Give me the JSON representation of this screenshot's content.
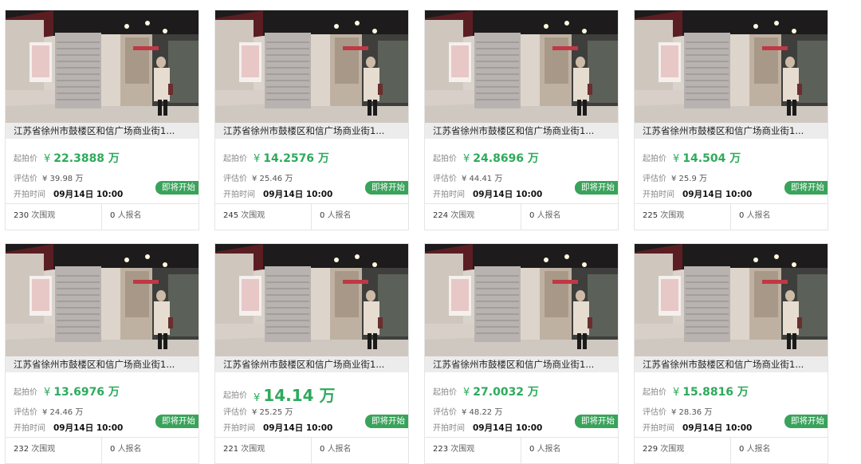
{
  "labels": {
    "start_price": "起拍价",
    "estimate": "评估价",
    "start_time": "开拍时间",
    "status": "即将开始",
    "views_suffix": "次围观",
    "signups_suffix": "人报名",
    "unit": "万",
    "yen": "¥"
  },
  "title": "江苏省徐州市鼓楼区和信广场商业街1...",
  "cards": [
    {
      "price": "22.3888",
      "estimate": "¥ 39.98 万",
      "time": "09月14日 10:00",
      "views": "230",
      "signups": "0"
    },
    {
      "price": "14.2576",
      "estimate": "¥ 25.46 万",
      "time": "09月14日 10:00",
      "views": "245",
      "signups": "0"
    },
    {
      "price": "24.8696",
      "estimate": "¥ 44.41 万",
      "time": "09月14日 10:00",
      "views": "224",
      "signups": "0"
    },
    {
      "price": "14.504",
      "estimate": "¥ 25.9 万",
      "time": "09月14日 10:00",
      "views": "225",
      "signups": "0"
    },
    {
      "price": "13.6976",
      "estimate": "¥ 24.46 万",
      "time": "09月14日 10:00",
      "views": "232",
      "signups": "0"
    },
    {
      "price": "14.14",
      "estimate": "¥ 25.25 万",
      "time": "09月14日 10:00",
      "views": "221",
      "signups": "0"
    },
    {
      "price": "27.0032",
      "estimate": "¥ 48.22 万",
      "time": "09月14日 10:00",
      "views": "223",
      "signups": "0"
    },
    {
      "price": "15.8816",
      "estimate": "¥ 28.36 万",
      "time": "09月14日 10:00",
      "views": "229",
      "signups": "0"
    }
  ],
  "colors": {
    "accent": "#2eaa5c",
    "badge": "#3aa35b"
  }
}
